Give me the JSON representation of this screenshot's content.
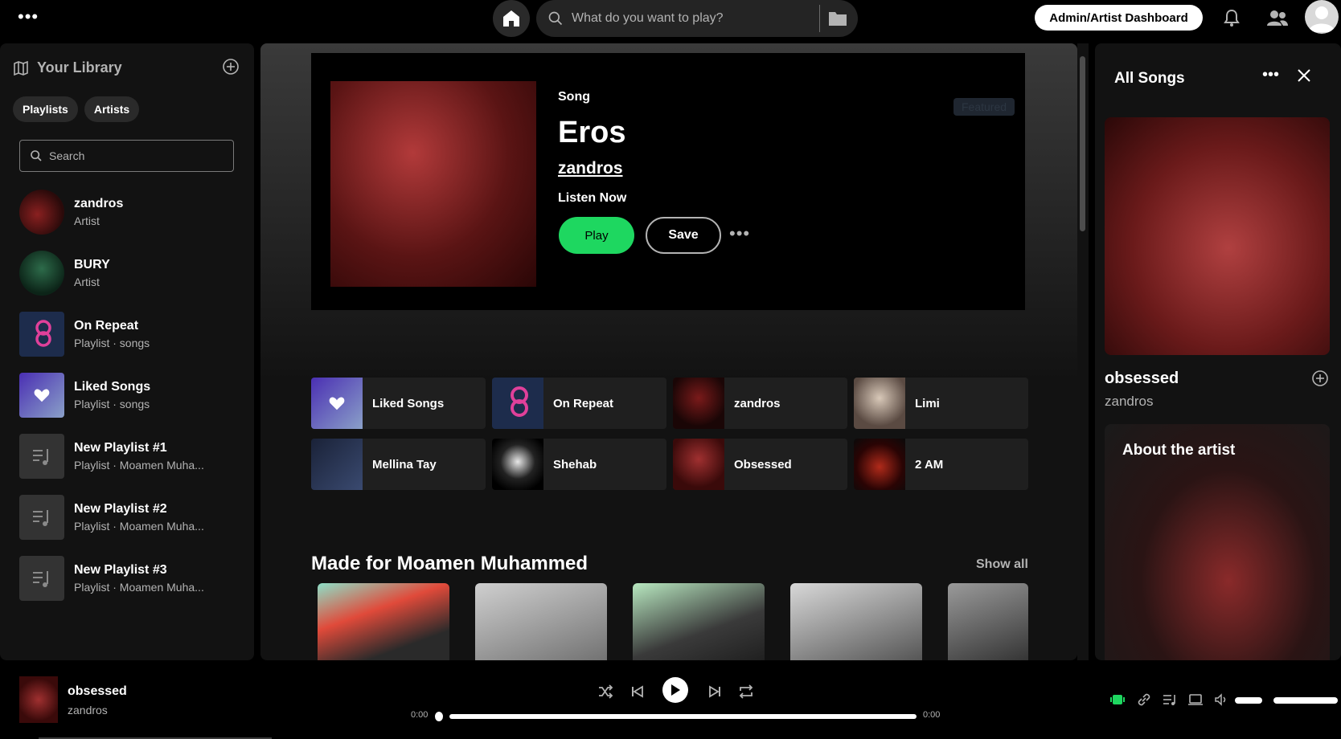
{
  "topbar": {
    "search_placeholder": "What do you want to play?",
    "dashboard_label": "Admin/Artist Dashboard"
  },
  "library": {
    "title": "Your Library",
    "chips": [
      "Playlists",
      "Artists"
    ],
    "search_placeholder": "Search",
    "items": [
      {
        "name": "zandros",
        "sub": "Artist"
      },
      {
        "name": "BURY",
        "sub": "Artist"
      },
      {
        "name": "On Repeat",
        "sub": "Playlist · songs"
      },
      {
        "name": "Liked Songs",
        "sub": "Playlist · songs"
      },
      {
        "name": "New Playlist #1",
        "sub": "Playlist · Moamen Muha..."
      },
      {
        "name": "New Playlist #2",
        "sub": "Playlist · Moamen Muha..."
      },
      {
        "name": "New Playlist #3",
        "sub": "Playlist · Moamen Muha..."
      }
    ]
  },
  "hero": {
    "type": "Song",
    "title": "Eros",
    "artist": "zandros",
    "cta": "Listen Now",
    "play_label": "Play",
    "save_label": "Save",
    "badge": "Featured"
  },
  "quick": [
    {
      "label": "Liked Songs"
    },
    {
      "label": "On Repeat"
    },
    {
      "label": "zandros"
    },
    {
      "label": "Limi"
    },
    {
      "label": "Mellina Tay"
    },
    {
      "label": "Shehab"
    },
    {
      "label": "Obsessed"
    },
    {
      "label": "2 AM"
    }
  ],
  "made_for": {
    "title": "Made for Moamen Muhammed",
    "show_all": "Show all"
  },
  "right_panel": {
    "title": "All Songs",
    "song": "obsessed",
    "artist": "zandros",
    "about": "About the artist"
  },
  "player": {
    "title": "obsessed",
    "artist": "zandros",
    "time_current": "0:00",
    "time_total": "0:00",
    "volume": 1.0
  },
  "colors": {
    "accent": "#1ed760",
    "background": "#121212"
  }
}
